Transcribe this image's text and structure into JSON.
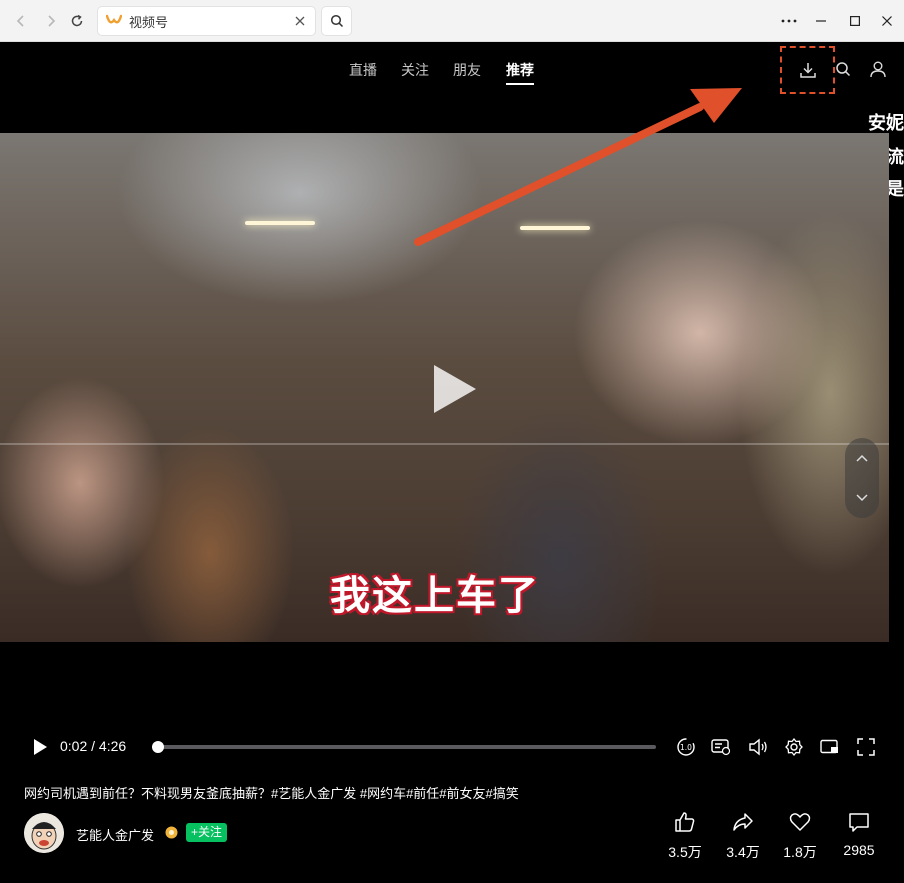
{
  "browser": {
    "tab_title": "视频号",
    "accent_color": "#f0a030"
  },
  "topnav": {
    "items": [
      {
        "label": "直播"
      },
      {
        "label": "关注"
      },
      {
        "label": "朋友"
      },
      {
        "label": "推荐",
        "active": true
      }
    ]
  },
  "side_text": [
    "安妮",
    "省流",
    "这只是"
  ],
  "video": {
    "subtitle": "我这上车了",
    "current_time": "0:02",
    "duration": "4:26",
    "time_display": "0:02 / 4:26",
    "progress_fraction": 0.0075
  },
  "controls": {
    "speed_label": "1.0",
    "icons": [
      "speed-icon",
      "danmaku-icon",
      "volume-icon",
      "settings-icon",
      "pip-icon",
      "fullscreen-icon"
    ]
  },
  "post": {
    "description": "网约司机遇到前任？不料现男友釜底抽薪？#艺能人金广发 #网约车#前任#前女友#搞笑",
    "author": "艺能人金广发",
    "follow_label": "+关注",
    "follow_color": "#07c160"
  },
  "stats": {
    "likes": "3.5万",
    "shares": "3.4万",
    "favorites": "1.8万",
    "comments": "2985"
  },
  "annotation": {
    "arrow_color": "#e0502a",
    "box_style": "dashed"
  }
}
